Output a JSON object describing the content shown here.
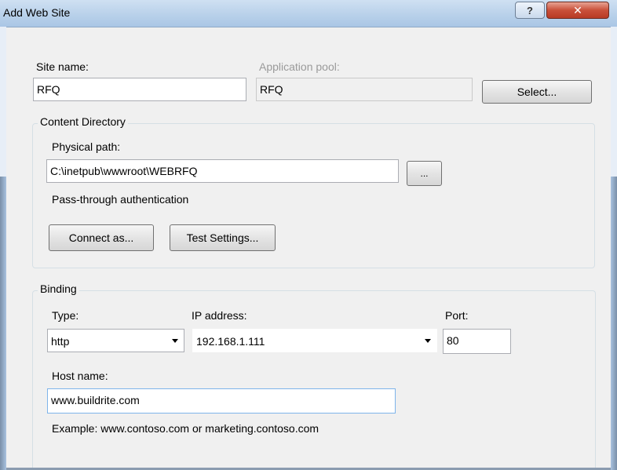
{
  "window": {
    "title": "Add Web Site",
    "help_glyph": "?",
    "close_glyph": "✕"
  },
  "site": {
    "name_label": "Site name:",
    "name_value": "RFQ",
    "pool_label": "Application pool:",
    "pool_value": "RFQ",
    "select_label": "Select..."
  },
  "content_directory": {
    "title": "Content Directory",
    "physical_path_label": "Physical path:",
    "physical_path_value": "C:\\inetpub\\wwwroot\\WEBRFQ",
    "browse_label": "...",
    "passthrough_label": "Pass-through authentication",
    "connect_as_label": "Connect as...",
    "test_settings_label": "Test Settings..."
  },
  "binding": {
    "title": "Binding",
    "type_label": "Type:",
    "type_value": "http",
    "ip_label": "IP address:",
    "ip_value": "192.168.1.111",
    "port_label": "Port:",
    "port_value": "80",
    "host_label": "Host name:",
    "host_value": "www.buildrite.com",
    "example_text": "Example: www.contoso.com or marketing.contoso.com"
  },
  "colors": {
    "title_bar": "#b9d1ea",
    "close_button": "#c9503a",
    "dialog_background": "#f0f0f0"
  }
}
